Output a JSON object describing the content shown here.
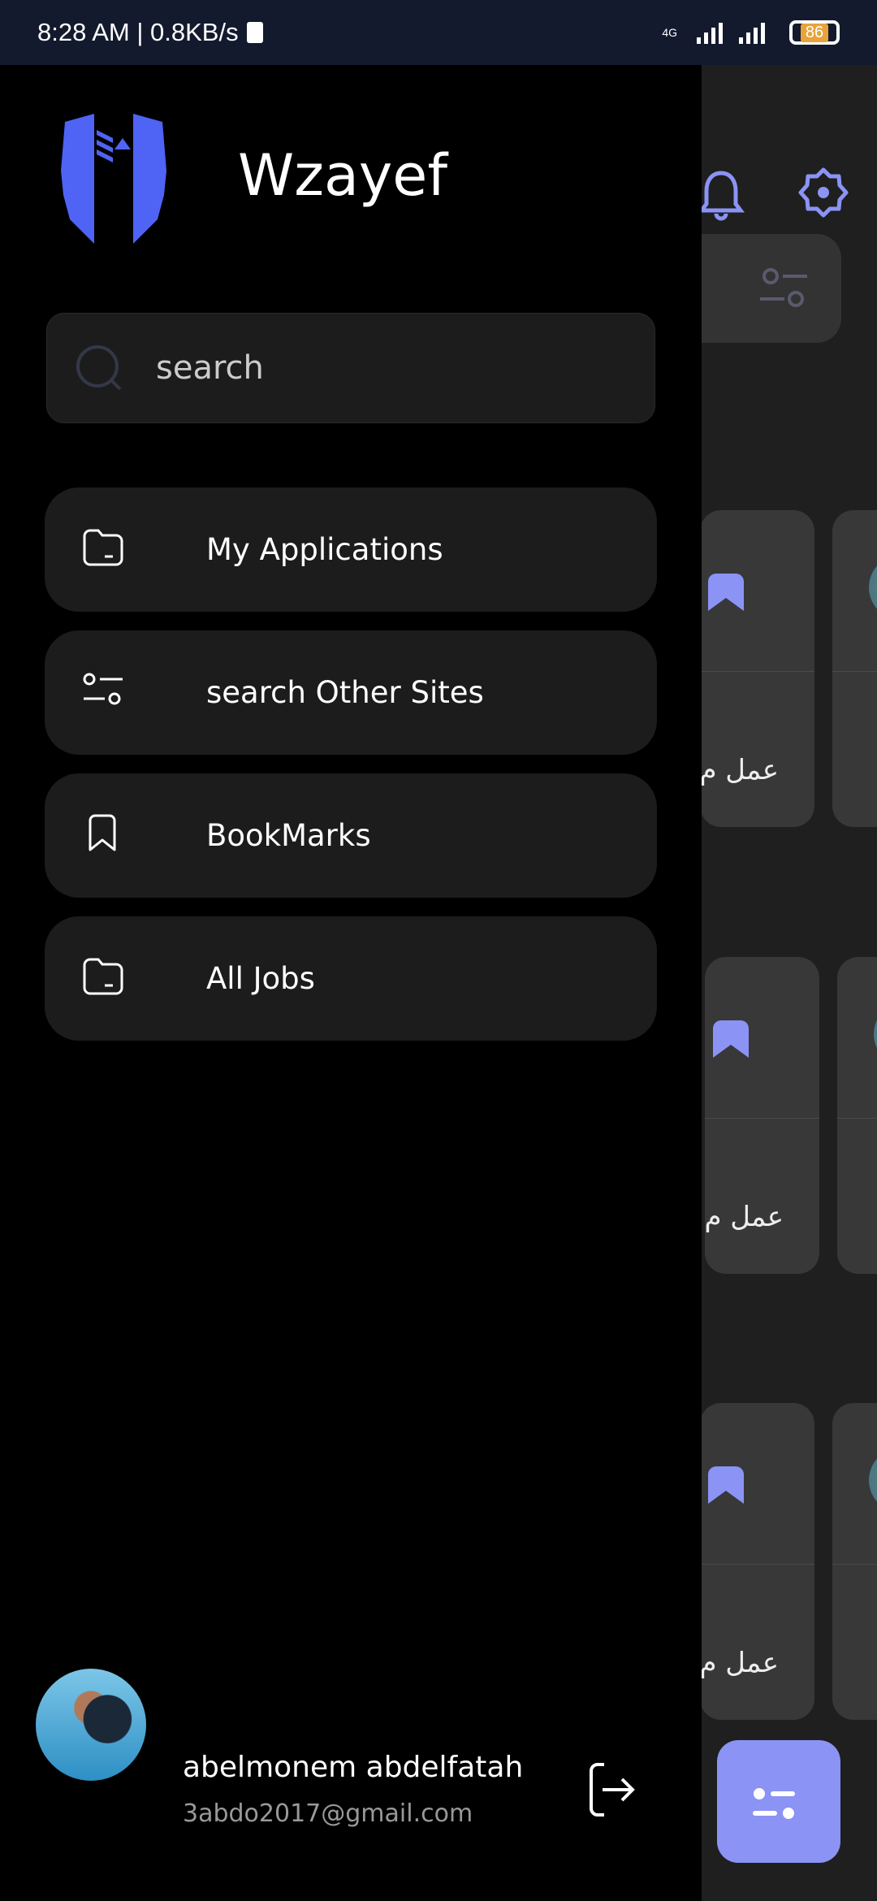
{
  "status_bar": {
    "time": "8:28 AM | 0.8KB/s",
    "network": "4G",
    "battery": "86"
  },
  "drawer": {
    "app_title": "Wzayef",
    "search": {
      "placeholder": "search"
    },
    "menu": [
      {
        "label": "My Applications",
        "icon": "folder-icon"
      },
      {
        "label": "search Other Sites",
        "icon": "filter-icon"
      },
      {
        "label": "BookMarks",
        "icon": "bookmark-icon"
      },
      {
        "label": "All Jobs",
        "icon": "folder-icon"
      }
    ],
    "user": {
      "name": "abelmonem abdelfatah",
      "email": "3abdo2017@gmail.com"
    }
  },
  "background": {
    "card_text": "عمل م"
  },
  "colors": {
    "accent": "#8b93f5",
    "logo": "#4f63f5",
    "drawer_bg": "#000000",
    "item_bg": "#1c1c1c"
  }
}
